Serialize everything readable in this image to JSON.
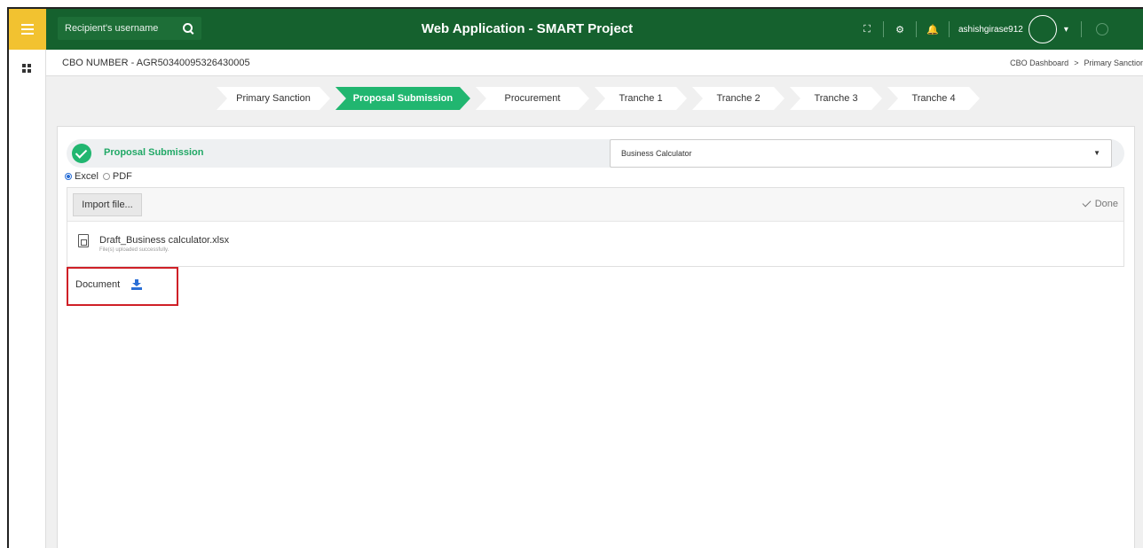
{
  "header": {
    "search_placeholder": "Recipient's username",
    "title": "Web Application - SMART Project",
    "user_name": "ashishgirase912",
    "icons": [
      "expand-icon",
      "gear-icon",
      "bell-icon",
      "power-icon"
    ]
  },
  "subheader": {
    "cbo_number": "CBO NUMBER - AGR50340095326430005",
    "breadcrumb": [
      "CBO Dashboard",
      "Primary Sanction"
    ],
    "breadcrumb_sep": ">"
  },
  "steps": [
    {
      "label": "Primary Sanction",
      "active": false
    },
    {
      "label": "Proposal Submission",
      "active": true
    },
    {
      "label": "Procurement",
      "active": false
    },
    {
      "label": "Tranche 1",
      "active": false
    },
    {
      "label": "Tranche 2",
      "active": false
    },
    {
      "label": "Tranche 3",
      "active": false
    },
    {
      "label": "Tranche 4",
      "active": false
    }
  ],
  "section": {
    "title": "Proposal Submission",
    "select_value": "Business Calculator"
  },
  "format": {
    "options": [
      "Excel",
      "PDF"
    ],
    "selected": "Excel"
  },
  "upload": {
    "import_label": "Import file...",
    "done_label": "Done",
    "file_name": "Draft_Business calculator.xlsx",
    "file_status": "File(s) uploaded successfully."
  },
  "document": {
    "label": "Document"
  },
  "colors": {
    "header_bg": "#15612e",
    "menu_accent": "#f2c230",
    "active_step": "#21b670",
    "highlight_border": "#cf2027",
    "download_icon": "#2a6fd6"
  }
}
